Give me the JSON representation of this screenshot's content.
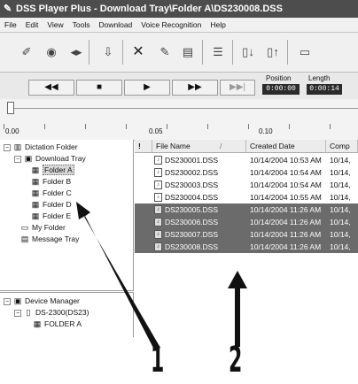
{
  "window": {
    "title": "DSS Player Plus - Download Tray\\Folder A\\DS230008.DSS"
  },
  "menu": [
    "File",
    "Edit",
    "View",
    "Tools",
    "Download",
    "Voice Recognition",
    "Help"
  ],
  "toolbar": {
    "icons": [
      "dictate-icon",
      "play-icon",
      "rewind-icon",
      "download-icon",
      "delete-icon",
      "edit-icon",
      "properties-icon",
      "list-icon",
      "send-icon",
      "receive-icon",
      "window-icon"
    ]
  },
  "transport": {
    "rewind": "◀◀",
    "stop": "■",
    "play": "▶",
    "ffwd": "▶▶",
    "end": "▶▶|",
    "position_label": "Position",
    "position_value": "0:00:00",
    "length_label": "Length",
    "length_value": "0:00:14"
  },
  "ruler": {
    "labels": [
      "0.00",
      "0.05",
      "0.10"
    ]
  },
  "tree": {
    "root": "Dictation Folder",
    "download_tray": "Download Tray",
    "folders": [
      "Folder A",
      "Folder B",
      "Folder C",
      "Folder D",
      "Folder E"
    ],
    "my_folder": "My Folder",
    "message_tray": "Message Tray",
    "device_manager": "Device Manager",
    "device": "DS-2300(DS23)",
    "device_folder": "FOLDER A"
  },
  "list": {
    "headers": {
      "flag": "!",
      "file_name": "File Name",
      "sort": "/",
      "created": "Created Date",
      "completed": "Comp"
    },
    "rows": [
      {
        "name": "DS230001.DSS",
        "created": "10/14/2004 10:53 AM",
        "comp": "10/14,",
        "highlighted": false
      },
      {
        "name": "DS230002.DSS",
        "created": "10/14/2004 10:54 AM",
        "comp": "10/14,",
        "highlighted": false
      },
      {
        "name": "DS230003.DSS",
        "created": "10/14/2004 10:54 AM",
        "comp": "10/14,",
        "highlighted": false
      },
      {
        "name": "DS230004.DSS",
        "created": "10/14/2004 10:55 AM",
        "comp": "10/14,",
        "highlighted": false
      },
      {
        "name": "DS230005.DSS",
        "created": "10/14/2004 11:26 AM",
        "comp": "10/14,",
        "highlighted": true
      },
      {
        "name": "DS230006.DSS",
        "created": "10/14/2004 11:26 AM",
        "comp": "10/14,",
        "highlighted": true
      },
      {
        "name": "DS230007.DSS",
        "created": "10/14/2004 11:26 AM",
        "comp": "10/14,",
        "highlighted": true
      },
      {
        "name": "DS230008.DSS",
        "created": "10/14/2004 11:26 AM",
        "comp": "10/14,",
        "highlighted": true
      }
    ]
  },
  "callouts": [
    "1",
    "2"
  ]
}
